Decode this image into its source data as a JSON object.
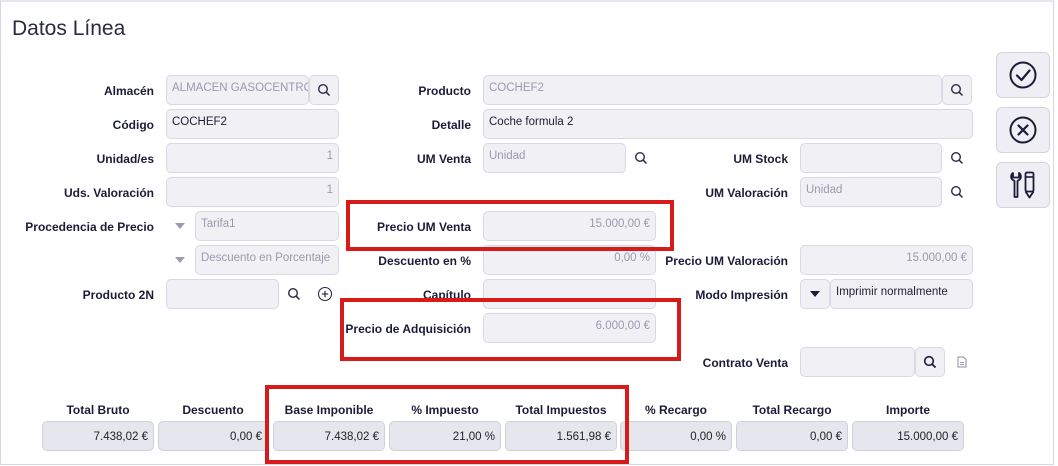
{
  "window": {
    "title": "Datos Línea"
  },
  "form": {
    "almacen": {
      "label": "Almacén",
      "value": "ALMACEN GASOCENTRO"
    },
    "codigo": {
      "label": "Código",
      "value": "COCHEF2"
    },
    "unidades": {
      "label": "Unidad/es",
      "value": "1"
    },
    "uds_valoracion": {
      "label": "Uds. Valoración",
      "value": "1"
    },
    "procedencia": {
      "label": "Procedencia de Precio",
      "value": "Tarifa1",
      "value2": "Descuento en Porcentaje"
    },
    "producto_2n": {
      "label": "Producto 2N",
      "value": ""
    },
    "producto": {
      "label": "Producto",
      "value": "COCHEF2"
    },
    "detalle": {
      "label": "Detalle",
      "value": "Coche formula 2"
    },
    "um_venta": {
      "label": "UM Venta",
      "value": "Unidad"
    },
    "precio_um_venta": {
      "label": "Precio UM Venta",
      "value": "15.000,00 €"
    },
    "descuento_pct": {
      "label": "Descuento en %",
      "value": "0,00 %"
    },
    "capitulo": {
      "label": "Capítulo",
      "value": ""
    },
    "precio_adquisicion": {
      "label": "Precio de Adquisición",
      "value": "6.000,00 €"
    },
    "um_stock": {
      "label": "UM Stock",
      "value": ""
    },
    "um_valoracion": {
      "label": "UM Valoración",
      "value": "Unidad"
    },
    "precio_um_valoracion": {
      "label": "Precio UM Valoración",
      "value": "15.000,00 €"
    },
    "modo_impresion": {
      "label": "Modo Impresión",
      "value": "Imprimir normalmente"
    },
    "contrato_venta": {
      "label": "Contrato Venta",
      "value": ""
    }
  },
  "totals": [
    {
      "label": "Total Bruto",
      "value": "7.438,02 €"
    },
    {
      "label": "Descuento",
      "value": "0,00 €"
    },
    {
      "label": "Base Imponible",
      "value": "7.438,02 €"
    },
    {
      "label": "% Impuesto",
      "value": "21,00 %"
    },
    {
      "label": "Total Impuestos",
      "value": "1.561,98 €"
    },
    {
      "label": "% Recargo",
      "value": "0,00 %"
    },
    {
      "label": "Total Recargo",
      "value": "0,00 €"
    },
    {
      "label": "Importe",
      "value": "15.000,00 €"
    }
  ],
  "actions": {
    "accept_icon": "check-circle-icon",
    "cancel_icon": "x-circle-icon",
    "tools_icon": "tools-icon"
  },
  "colors": {
    "highlight": "#d71a1a",
    "field_bg": "#f0f0f5",
    "icon": "#1c1c38"
  }
}
